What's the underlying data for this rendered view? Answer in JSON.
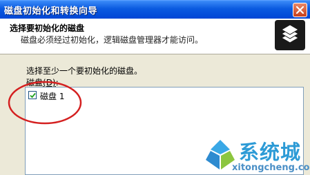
{
  "window": {
    "title": "磁盘初始化和转换向导"
  },
  "header": {
    "title": "选择要初始化的磁盘",
    "subtitle": "磁盘必须经过初始化，逻辑磁盘管理器才能访问。",
    "icon": "stacked-disks-icon"
  },
  "body": {
    "prompt": "选择至少一个要初始化的磁盘。",
    "disks_label": "磁盘",
    "disks_label_accel": "(D)",
    "disks_label_colon": ":",
    "disks": [
      {
        "label": "磁盘 1",
        "checked": true
      }
    ]
  },
  "annotation": {
    "color": "#d42020"
  },
  "watermark": {
    "name": "系统城",
    "url": "xitongcheng.com"
  },
  "colors": {
    "titlebar": "#0a5ae0",
    "dialog_bg": "#ece9d8",
    "close": "#c8401c"
  }
}
